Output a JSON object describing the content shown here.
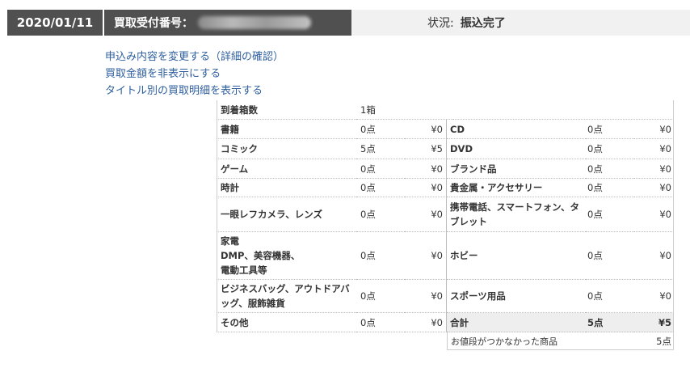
{
  "header": {
    "date": "2020/01/11",
    "ticket_label": "買取受付番号：",
    "status_label": "状況:",
    "status_value": "振込完了"
  },
  "links": [
    "申込み内容を変更する（詳細の確認）",
    "買取金額を非表示にする",
    "タイトル別の買取明細を表示する"
  ],
  "arrival": {
    "label": "到着箱数",
    "value": "1箱"
  },
  "rows": [
    {
      "l_label": "書籍",
      "l_count": "0点",
      "l_price": "¥0",
      "r_label": "CD",
      "r_count": "0点",
      "r_price": "¥0"
    },
    {
      "l_label": "コミック",
      "l_count": "5点",
      "l_price": "¥5",
      "r_label": "DVD",
      "r_count": "0点",
      "r_price": "¥0"
    },
    {
      "l_label": "ゲーム",
      "l_count": "0点",
      "l_price": "¥0",
      "r_label": "ブランド品",
      "r_count": "0点",
      "r_price": "¥0"
    },
    {
      "l_label": "時計",
      "l_count": "0点",
      "l_price": "¥0",
      "r_label": "貴金属・アクセサリー",
      "r_count": "0点",
      "r_price": "¥0"
    },
    {
      "l_label": "一眼レフカメラ、レンズ",
      "l_count": "0点",
      "l_price": "¥0",
      "r_label": "携帯電話、スマートフォン、タブレット",
      "r_count": "0点",
      "r_price": "¥0"
    },
    {
      "l_label": "家電\nDMP、美容機器、\n電動工具等",
      "l_count": "0点",
      "l_price": "¥0",
      "r_label": "ホビー",
      "r_count": "0点",
      "r_price": "¥0"
    },
    {
      "l_label": "ビジネスバッグ、アウトドアバッグ、服飾雑貨",
      "l_count": "0点",
      "l_price": "¥0",
      "r_label": "スポーツ用品",
      "r_count": "0点",
      "r_price": "¥0"
    },
    {
      "l_label": "その他",
      "l_count": "0点",
      "l_price": "¥0",
      "r_label": "合計",
      "r_count": "5点",
      "r_price": "¥5"
    }
  ],
  "footer": {
    "label": "お値段がつかなかった商品",
    "value": "5点"
  }
}
